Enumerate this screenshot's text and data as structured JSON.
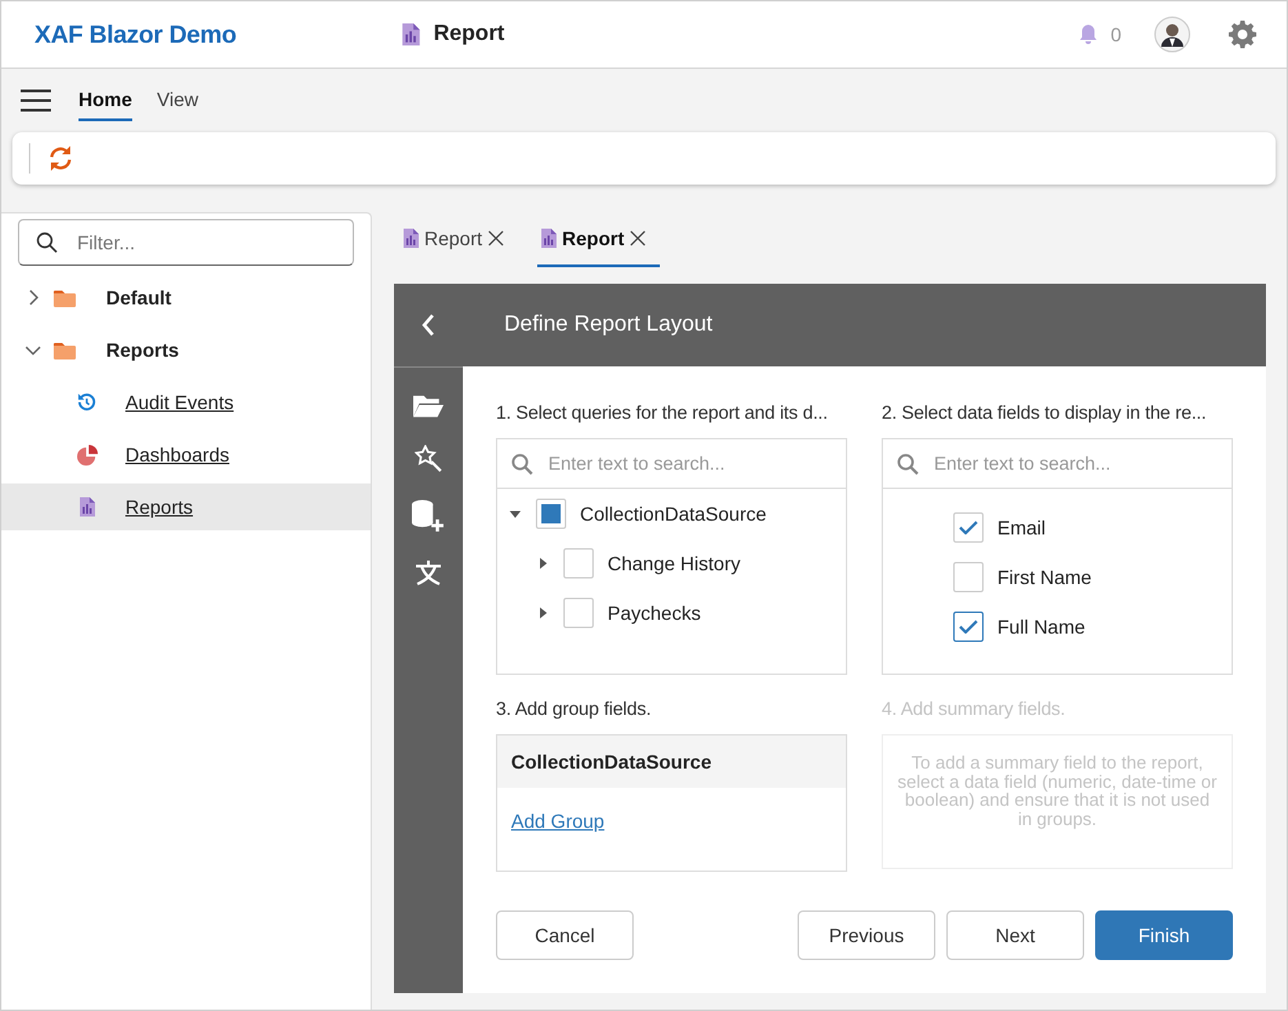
{
  "app": {
    "title": "XAF Blazor Demo",
    "page_title": "Report",
    "notification_count": "0"
  },
  "toolbar": {
    "tabs": [
      {
        "label": "Home",
        "selected": true
      },
      {
        "label": "View",
        "selected": false
      }
    ]
  },
  "navigation": {
    "filter_placeholder": "Filter...",
    "items": [
      {
        "label": "Default",
        "kind": "folder",
        "expanded": false,
        "selected": false
      },
      {
        "label": "Reports",
        "kind": "folder",
        "expanded": true,
        "selected": false,
        "children": [
          {
            "label": "Audit Events",
            "kind": "history",
            "selected": false
          },
          {
            "label": "Dashboards",
            "kind": "dashboard",
            "selected": false
          },
          {
            "label": "Reports",
            "kind": "report",
            "selected": true
          }
        ]
      }
    ]
  },
  "document_tabs": [
    {
      "label": "Report",
      "selected": false
    },
    {
      "label": "Report",
      "selected": true
    }
  ],
  "wizard": {
    "title": "Define Report Layout",
    "queries": {
      "label": "1. Select queries for the report and its d...",
      "placeholder": "Enter text to search...",
      "items": [
        {
          "label": "CollectionDataSource",
          "checked": false,
          "indeterminate": true,
          "expanded": true,
          "children": [
            {
              "label": "Change History",
              "checked": false,
              "indeterminate": false,
              "expanded": false
            },
            {
              "label": "Paychecks",
              "checked": false,
              "indeterminate": false,
              "expanded": false
            }
          ]
        }
      ]
    },
    "fields": {
      "label": "2. Select data fields to display in the re...",
      "placeholder": "Enter text to search...",
      "items": [
        {
          "label": "Email",
          "checked": true
        },
        {
          "label": "First Name",
          "checked": false
        },
        {
          "label": "Full Name",
          "checked": true
        }
      ]
    },
    "groups": {
      "label": "3. Add group fields.",
      "source": "CollectionDataSource",
      "link": "Add Group"
    },
    "summary": {
      "label": "4. Add summary fields.",
      "disabled": true,
      "hint": "To add a summary field to the report, select a data field (numeric, date-time or boolean) and ensure that it is not used in groups."
    },
    "buttons": [
      {
        "label": "Cancel",
        "kind": "cancel"
      },
      {
        "label": "Previous",
        "kind": "secondary"
      },
      {
        "label": "Next",
        "kind": "secondary"
      },
      {
        "label": "Finish",
        "kind": "primary"
      }
    ]
  }
}
